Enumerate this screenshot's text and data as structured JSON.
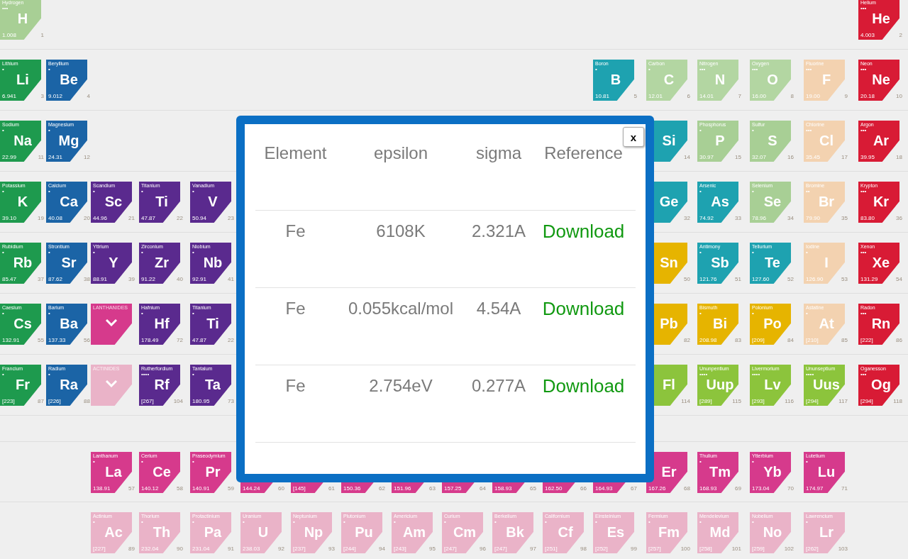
{
  "periodic_table": {
    "rows": [
      {
        "tiles": [
          {
            "kind": "element",
            "name": "Hydrogen",
            "marks": "•••",
            "symbol": "H",
            "mass": "1.008",
            "number": "1",
            "color": "#a8cf95"
          },
          {
            "kind": "blank"
          },
          {
            "kind": "blank"
          },
          {
            "kind": "blank"
          },
          {
            "kind": "blank"
          },
          {
            "kind": "blank"
          },
          {
            "kind": "blank"
          },
          {
            "kind": "blank"
          },
          {
            "kind": "blank"
          },
          {
            "kind": "blank"
          },
          {
            "kind": "blank"
          },
          {
            "kind": "blank"
          },
          {
            "kind": "blank"
          },
          {
            "kind": "blank"
          },
          {
            "kind": "blank"
          },
          {
            "kind": "blank"
          },
          {
            "kind": "blank"
          },
          {
            "kind": "element",
            "name": "Helium",
            "marks": "•••",
            "symbol": "He",
            "mass": "4.003",
            "number": "2",
            "color": "#d81b35"
          }
        ]
      },
      {
        "tiles": [
          {
            "kind": "element",
            "name": "Lithium",
            "marks": "•",
            "symbol": "Li",
            "mass": "6.941",
            "number": "3",
            "color": "#1e9a4e"
          },
          {
            "kind": "element",
            "name": "Beryllium",
            "marks": "•",
            "symbol": "Be",
            "mass": "9.012",
            "number": "4",
            "color": "#1b64a6"
          },
          {
            "kind": "blank"
          },
          {
            "kind": "blank"
          },
          {
            "kind": "blank"
          },
          {
            "kind": "blank"
          },
          {
            "kind": "blank"
          },
          {
            "kind": "blank"
          },
          {
            "kind": "blank"
          },
          {
            "kind": "blank"
          },
          {
            "kind": "blank"
          },
          {
            "kind": "blank"
          },
          {
            "kind": "element",
            "name": "Boron",
            "marks": "•",
            "symbol": "B",
            "mass": "10.81",
            "number": "5",
            "color": "#1ea2b0"
          },
          {
            "kind": "element",
            "name": "Carbon",
            "marks": "•",
            "symbol": "C",
            "mass": "12.01",
            "number": "6",
            "color": "#b3d6a2"
          },
          {
            "kind": "element",
            "name": "Nitrogen",
            "marks": "•••",
            "symbol": "N",
            "mass": "14.01",
            "number": "7",
            "color": "#b3d6a2"
          },
          {
            "kind": "element",
            "name": "Oxygen",
            "marks": "•••",
            "symbol": "O",
            "mass": "16.00",
            "number": "8",
            "color": "#b3d6a2"
          },
          {
            "kind": "element",
            "name": "Fluorine",
            "marks": "•••",
            "symbol": "F",
            "mass": "19.00",
            "number": "9",
            "color": "#f3d2b0"
          },
          {
            "kind": "element",
            "name": "Neon",
            "marks": "•••",
            "symbol": "Ne",
            "mass": "20.18",
            "number": "10",
            "color": "#d81b35"
          }
        ]
      },
      {
        "tiles": [
          {
            "kind": "element",
            "name": "Sodium",
            "marks": "•",
            "symbol": "Na",
            "mass": "22.99",
            "number": "11",
            "color": "#1e9a4e"
          },
          {
            "kind": "element",
            "name": "Magnesium",
            "marks": "•",
            "symbol": "Mg",
            "mass": "24.31",
            "number": "12",
            "color": "#1b64a6"
          },
          {
            "kind": "blank"
          },
          {
            "kind": "blank"
          },
          {
            "kind": "blank"
          },
          {
            "kind": "blank"
          },
          {
            "kind": "blank"
          },
          {
            "kind": "blank"
          },
          {
            "kind": "blank"
          },
          {
            "kind": "blank"
          },
          {
            "kind": "blank"
          },
          {
            "kind": "blank"
          },
          {
            "kind": "blank"
          },
          {
            "kind": "element",
            "symbol": "Si",
            "number": "14",
            "color": "#1ea2b0"
          },
          {
            "kind": "element",
            "name": "Phosphorus",
            "marks": "•",
            "symbol": "P",
            "mass": "30.97",
            "number": "15",
            "color": "#a8cf95"
          },
          {
            "kind": "element",
            "name": "Sulfur",
            "marks": "•",
            "symbol": "S",
            "mass": "32.07",
            "number": "16",
            "color": "#a8cf95"
          },
          {
            "kind": "element",
            "name": "Chlorine",
            "marks": "•••",
            "symbol": "Cl",
            "mass": "35.45",
            "number": "17",
            "color": "#f3d2b0"
          },
          {
            "kind": "element",
            "name": "Argon",
            "marks": "•••",
            "symbol": "Ar",
            "mass": "39.95",
            "number": "18",
            "color": "#d81b35"
          }
        ]
      },
      {
        "tiles": [
          {
            "kind": "element",
            "name": "Potassium",
            "marks": "•",
            "symbol": "K",
            "mass": "39.10",
            "number": "19",
            "color": "#1e9a4e"
          },
          {
            "kind": "element",
            "name": "Calcium",
            "marks": "•",
            "symbol": "Ca",
            "mass": "40.08",
            "number": "20",
            "color": "#1b64a6"
          },
          {
            "kind": "element",
            "name": "Scandium",
            "marks": "•",
            "symbol": "Sc",
            "mass": "44.96",
            "number": "21",
            "color": "#5a2a8e"
          },
          {
            "kind": "element",
            "name": "Titanium",
            "marks": "•",
            "symbol": "Ti",
            "mass": "47.87",
            "number": "22",
            "color": "#5a2a8e"
          },
          {
            "kind": "element",
            "name": "Vanadium",
            "marks": "•",
            "symbol": "V",
            "mass": "50.94",
            "number": "23",
            "color": "#5a2a8e"
          },
          {
            "kind": "blank"
          },
          {
            "kind": "blank"
          },
          {
            "kind": "blank"
          },
          {
            "kind": "blank"
          },
          {
            "kind": "blank"
          },
          {
            "kind": "blank"
          },
          {
            "kind": "blank"
          },
          {
            "kind": "blank"
          },
          {
            "kind": "element",
            "symbol": "Ge",
            "number": "32",
            "color": "#1ea2b0"
          },
          {
            "kind": "element",
            "name": "Arsenic",
            "marks": "•",
            "symbol": "As",
            "mass": "74.92",
            "number": "33",
            "color": "#1ea2b0"
          },
          {
            "kind": "element",
            "name": "Selenium",
            "marks": "•",
            "symbol": "Se",
            "mass": "78.96",
            "number": "34",
            "color": "#a8cf95"
          },
          {
            "kind": "element",
            "name": "Bromine",
            "marks": "••",
            "symbol": "Br",
            "mass": "79.90",
            "number": "35",
            "color": "#f3d2b0"
          },
          {
            "kind": "element",
            "name": "Krypton",
            "marks": "•••",
            "symbol": "Kr",
            "mass": "83.80",
            "number": "36",
            "color": "#d81b35"
          }
        ]
      },
      {
        "tiles": [
          {
            "kind": "element",
            "name": "Rubidium",
            "marks": "•",
            "symbol": "Rb",
            "mass": "85.47",
            "number": "37",
            "color": "#1e9a4e"
          },
          {
            "kind": "element",
            "name": "Strontium",
            "marks": "•",
            "symbol": "Sr",
            "mass": "87.62",
            "number": "38",
            "color": "#1b64a6"
          },
          {
            "kind": "element",
            "name": "Yttrium",
            "marks": "•",
            "symbol": "Y",
            "mass": "88.91",
            "number": "39",
            "color": "#5a2a8e"
          },
          {
            "kind": "element",
            "name": "Zirconium",
            "marks": "•",
            "symbol": "Zr",
            "mass": "91.22",
            "number": "40",
            "color": "#5a2a8e"
          },
          {
            "kind": "element",
            "name": "Niobium",
            "marks": "•",
            "symbol": "Nb",
            "mass": "92.91",
            "number": "41",
            "color": "#5a2a8e"
          },
          {
            "kind": "blank"
          },
          {
            "kind": "blank"
          },
          {
            "kind": "blank"
          },
          {
            "kind": "blank"
          },
          {
            "kind": "blank"
          },
          {
            "kind": "blank"
          },
          {
            "kind": "blank"
          },
          {
            "kind": "blank"
          },
          {
            "kind": "element",
            "symbol": "Sn",
            "number": "50",
            "color": "#e6b400"
          },
          {
            "kind": "element",
            "name": "Antimony",
            "marks": "•",
            "symbol": "Sb",
            "mass": "121.76",
            "number": "51",
            "color": "#1ea2b0"
          },
          {
            "kind": "element",
            "name": "Tellurium",
            "marks": "•",
            "symbol": "Te",
            "mass": "127.60",
            "number": "52",
            "color": "#1ea2b0"
          },
          {
            "kind": "element",
            "name": "Iodine",
            "marks": "•",
            "symbol": "I",
            "mass": "126.90",
            "number": "53",
            "color": "#f3d2b0"
          },
          {
            "kind": "element",
            "name": "Xenon",
            "marks": "•••",
            "symbol": "Xe",
            "mass": "131.29",
            "number": "54",
            "color": "#d81b35"
          }
        ]
      },
      {
        "tiles": [
          {
            "kind": "element",
            "name": "Caesium",
            "marks": "•",
            "symbol": "Cs",
            "mass": "132.91",
            "number": "55",
            "color": "#1e9a4e"
          },
          {
            "kind": "element",
            "name": "Barium",
            "marks": "•",
            "symbol": "Ba",
            "mass": "137.33",
            "number": "56",
            "color": "#1b64a6"
          },
          {
            "kind": "group",
            "label": "LANTHANIDES",
            "color": "#d63a8c"
          },
          {
            "kind": "element",
            "name": "Hafnium",
            "marks": "•",
            "symbol": "Hf",
            "mass": "178.49",
            "number": "72",
            "color": "#5a2a8e"
          },
          {
            "kind": "element",
            "name": "Titanium",
            "marks": "•",
            "symbol": "Ti",
            "mass": "47.87",
            "number": "22",
            "color": "#5a2a8e"
          },
          {
            "kind": "blank"
          },
          {
            "kind": "blank"
          },
          {
            "kind": "blank"
          },
          {
            "kind": "blank"
          },
          {
            "kind": "blank"
          },
          {
            "kind": "blank"
          },
          {
            "kind": "blank"
          },
          {
            "kind": "blank"
          },
          {
            "kind": "element",
            "symbol": "Pb",
            "number": "82",
            "color": "#e6b400"
          },
          {
            "kind": "element",
            "name": "Bismuth",
            "marks": "•",
            "symbol": "Bi",
            "mass": "208.98",
            "number": "83",
            "color": "#e6b400"
          },
          {
            "kind": "element",
            "name": "Polonium",
            "marks": "•",
            "symbol": "Po",
            "mass": "[209]",
            "number": "84",
            "color": "#e6b400"
          },
          {
            "kind": "element",
            "name": "Astatine",
            "marks": "•",
            "symbol": "At",
            "mass": "[210]",
            "number": "85",
            "color": "#f3d2b0"
          },
          {
            "kind": "element",
            "name": "Radon",
            "marks": "•••",
            "symbol": "Rn",
            "mass": "[222]",
            "number": "86",
            "color": "#d81b35"
          }
        ]
      },
      {
        "tiles": [
          {
            "kind": "element",
            "name": "Francium",
            "marks": "•",
            "symbol": "Fr",
            "mass": "[223]",
            "number": "87",
            "color": "#1e9a4e"
          },
          {
            "kind": "element",
            "name": "Radium",
            "marks": "•",
            "symbol": "Ra",
            "mass": "[226]",
            "number": "88",
            "color": "#1b64a6"
          },
          {
            "kind": "group",
            "label": "ACTINIDES",
            "color": "#eab3c8"
          },
          {
            "kind": "element",
            "name": "Rutherfordium",
            "marks": "••••",
            "symbol": "Rf",
            "mass": "[267]",
            "number": "104",
            "color": "#5a2a8e"
          },
          {
            "kind": "element",
            "name": "Tantalum",
            "marks": "•",
            "symbol": "Ta",
            "mass": "180.95",
            "number": "73",
            "color": "#5a2a8e"
          },
          {
            "kind": "blank"
          },
          {
            "kind": "blank"
          },
          {
            "kind": "blank"
          },
          {
            "kind": "blank"
          },
          {
            "kind": "blank"
          },
          {
            "kind": "blank"
          },
          {
            "kind": "blank"
          },
          {
            "kind": "blank"
          },
          {
            "kind": "element",
            "symbol": "Fl",
            "number": "114",
            "color": "#8cc43c"
          },
          {
            "kind": "element",
            "name": "Ununpentium",
            "marks": "••••",
            "symbol": "Uup",
            "mass": "[289]",
            "number": "115",
            "color": "#8cc43c"
          },
          {
            "kind": "element",
            "name": "Livermorium",
            "marks": "••••",
            "symbol": "Lv",
            "mass": "[293]",
            "number": "116",
            "color": "#8cc43c"
          },
          {
            "kind": "element",
            "name": "Ununseptium",
            "marks": "••••",
            "symbol": "Uus",
            "mass": "[294]",
            "number": "117",
            "color": "#8cc43c"
          },
          {
            "kind": "element",
            "name": "Oganesson",
            "marks": "•••",
            "symbol": "Og",
            "mass": "[294]",
            "number": "118",
            "color": "#d81b35"
          }
        ]
      },
      {
        "tiles": [
          {
            "kind": "blank"
          },
          {
            "kind": "blank"
          },
          {
            "kind": "element",
            "name": "Lanthanum",
            "marks": "•",
            "symbol": "La",
            "mass": "138.91",
            "number": "57",
            "color": "#d63a8c"
          },
          {
            "kind": "element",
            "name": "Cerium",
            "marks": "•",
            "symbol": "Ce",
            "mass": "140.12",
            "number": "58",
            "color": "#d63a8c"
          },
          {
            "kind": "element",
            "name": "Praseodymium",
            "marks": "•",
            "symbol": "Pr",
            "mass": "140.91",
            "number": "59",
            "color": "#d63a8c"
          },
          {
            "kind": "element",
            "mass": "144.24",
            "number": "60",
            "color": "#d63a8c"
          },
          {
            "kind": "element",
            "mass": "[145]",
            "number": "61",
            "color": "#d63a8c"
          },
          {
            "kind": "element",
            "mass": "150.36",
            "number": "62",
            "color": "#d63a8c"
          },
          {
            "kind": "element",
            "mass": "151.96",
            "number": "63",
            "color": "#d63a8c"
          },
          {
            "kind": "element",
            "mass": "157.25",
            "number": "64",
            "color": "#d63a8c"
          },
          {
            "kind": "element",
            "mass": "158.93",
            "number": "65",
            "color": "#d63a8c"
          },
          {
            "kind": "element",
            "mass": "162.50",
            "number": "66",
            "color": "#d63a8c"
          },
          {
            "kind": "element",
            "mass": "164.93",
            "number": "67",
            "color": "#d63a8c"
          },
          {
            "kind": "element",
            "symbol": "Er",
            "mass": "167.26",
            "number": "68",
            "color": "#d63a8c"
          },
          {
            "kind": "element",
            "name": "Thulium",
            "marks": "•",
            "symbol": "Tm",
            "mass": "168.93",
            "number": "69",
            "color": "#d63a8c"
          },
          {
            "kind": "element",
            "name": "Ytterbium",
            "marks": "•",
            "symbol": "Yb",
            "mass": "173.04",
            "number": "70",
            "color": "#d63a8c"
          },
          {
            "kind": "element",
            "name": "Lutetium",
            "marks": "•",
            "symbol": "Lu",
            "mass": "174.97",
            "number": "71",
            "color": "#d63a8c"
          },
          {
            "kind": "blank"
          }
        ]
      },
      {
        "tiles": [
          {
            "kind": "blank"
          },
          {
            "kind": "blank"
          },
          {
            "kind": "element",
            "name": "Actinium",
            "marks": "•",
            "symbol": "Ac",
            "mass": "[227]",
            "number": "89",
            "color": "#eab3c8"
          },
          {
            "kind": "element",
            "name": "Thorium",
            "marks": "•",
            "symbol": "Th",
            "mass": "232.04",
            "number": "90",
            "color": "#eab3c8"
          },
          {
            "kind": "element",
            "name": "Protactinium",
            "marks": "•",
            "symbol": "Pa",
            "mass": "231.04",
            "number": "91",
            "color": "#eab3c8"
          },
          {
            "kind": "element",
            "name": "Uranium",
            "marks": "•",
            "symbol": "U",
            "mass": "238.03",
            "number": "92",
            "color": "#eab3c8"
          },
          {
            "kind": "element",
            "name": "Neptunium",
            "marks": "•",
            "symbol": "Np",
            "mass": "[237]",
            "number": "93",
            "color": "#eab3c8"
          },
          {
            "kind": "element",
            "name": "Plutonium",
            "marks": "•",
            "symbol": "Pu",
            "mass": "[244]",
            "number": "94",
            "color": "#eab3c8"
          },
          {
            "kind": "element",
            "name": "Americium",
            "marks": "•",
            "symbol": "Am",
            "mass": "[243]",
            "number": "95",
            "color": "#eab3c8"
          },
          {
            "kind": "element",
            "name": "Curium",
            "marks": "•",
            "symbol": "Cm",
            "mass": "[247]",
            "number": "96",
            "color": "#eab3c8"
          },
          {
            "kind": "element",
            "name": "Berkelium",
            "marks": "•",
            "symbol": "Bk",
            "mass": "[247]",
            "number": "97",
            "color": "#eab3c8"
          },
          {
            "kind": "element",
            "name": "Californium",
            "marks": "•",
            "symbol": "Cf",
            "mass": "[251]",
            "number": "98",
            "color": "#eab3c8"
          },
          {
            "kind": "element",
            "name": "Einsteinium",
            "marks": "•",
            "symbol": "Es",
            "mass": "[252]",
            "number": "99",
            "color": "#eab3c8"
          },
          {
            "kind": "element",
            "name": "Fermium",
            "marks": "•",
            "symbol": "Fm",
            "mass": "[257]",
            "number": "100",
            "color": "#eab3c8"
          },
          {
            "kind": "element",
            "name": "Mendelevium",
            "marks": "•",
            "symbol": "Md",
            "mass": "[258]",
            "number": "101",
            "color": "#eab3c8"
          },
          {
            "kind": "element",
            "name": "Nobelium",
            "marks": "•",
            "symbol": "No",
            "mass": "[259]",
            "number": "102",
            "color": "#eab3c8"
          },
          {
            "kind": "element",
            "name": "Lawrencium",
            "marks": "•",
            "symbol": "Lr",
            "mass": "[262]",
            "number": "103",
            "color": "#eab3c8"
          },
          {
            "kind": "blank"
          }
        ]
      }
    ]
  },
  "dialog": {
    "close": "x",
    "columns": [
      "Element",
      "epsilon",
      "sigma",
      "Reference"
    ],
    "rows": [
      {
        "element": "Fe",
        "epsilon": "6108K",
        "sigma": "2.321A",
        "reference": "Download"
      },
      {
        "element": "Fe",
        "epsilon": "0.055kcal/mol",
        "sigma": "4.54A",
        "reference": "Download"
      },
      {
        "element": "Fe",
        "epsilon": "2.754eV",
        "sigma": "0.277A",
        "reference": "Download"
      }
    ]
  }
}
